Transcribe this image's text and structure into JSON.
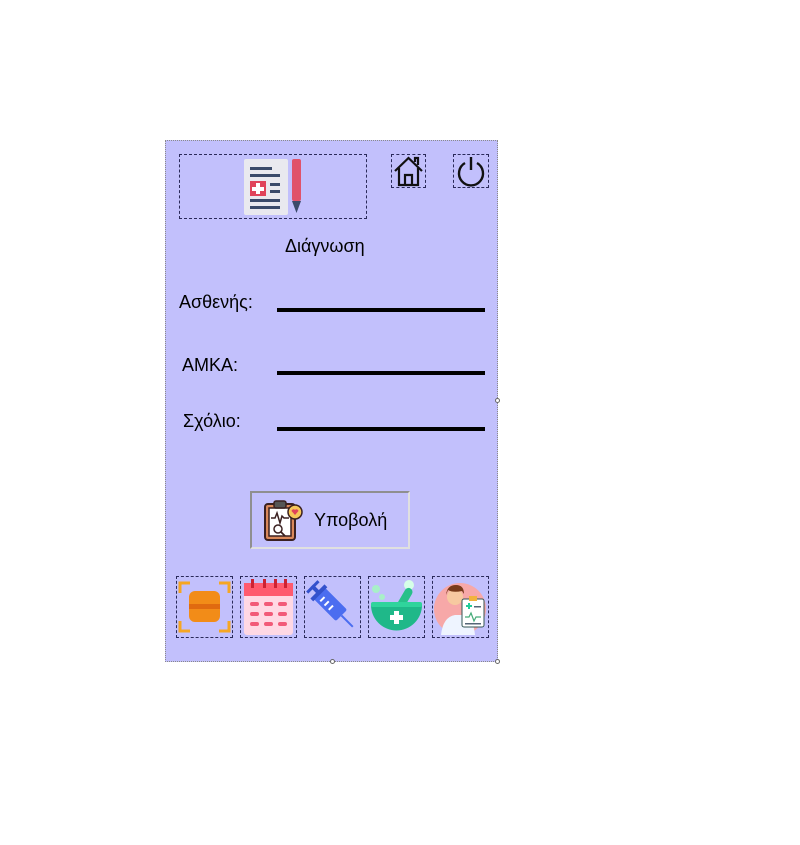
{
  "header": {
    "title": "Διάγνωση",
    "logo_icon": "medical-report-pencil-icon",
    "home_icon": "home-icon",
    "power_icon": "power-icon"
  },
  "form": {
    "patient_label": "Ασθενής:",
    "amka_label": "AMKA:",
    "comment_label": "Σχόλιο:"
  },
  "submit": {
    "label": "Υποβολή",
    "icon": "clipboard-heartbeat-icon"
  },
  "bottom_nav": [
    {
      "icon": "scan-icon"
    },
    {
      "icon": "calendar-icon"
    },
    {
      "icon": "syringe-icon"
    },
    {
      "icon": "mortar-pestle-icon"
    },
    {
      "icon": "doctor-icon"
    }
  ],
  "colors": {
    "panel_background": "#c2c0fc"
  }
}
